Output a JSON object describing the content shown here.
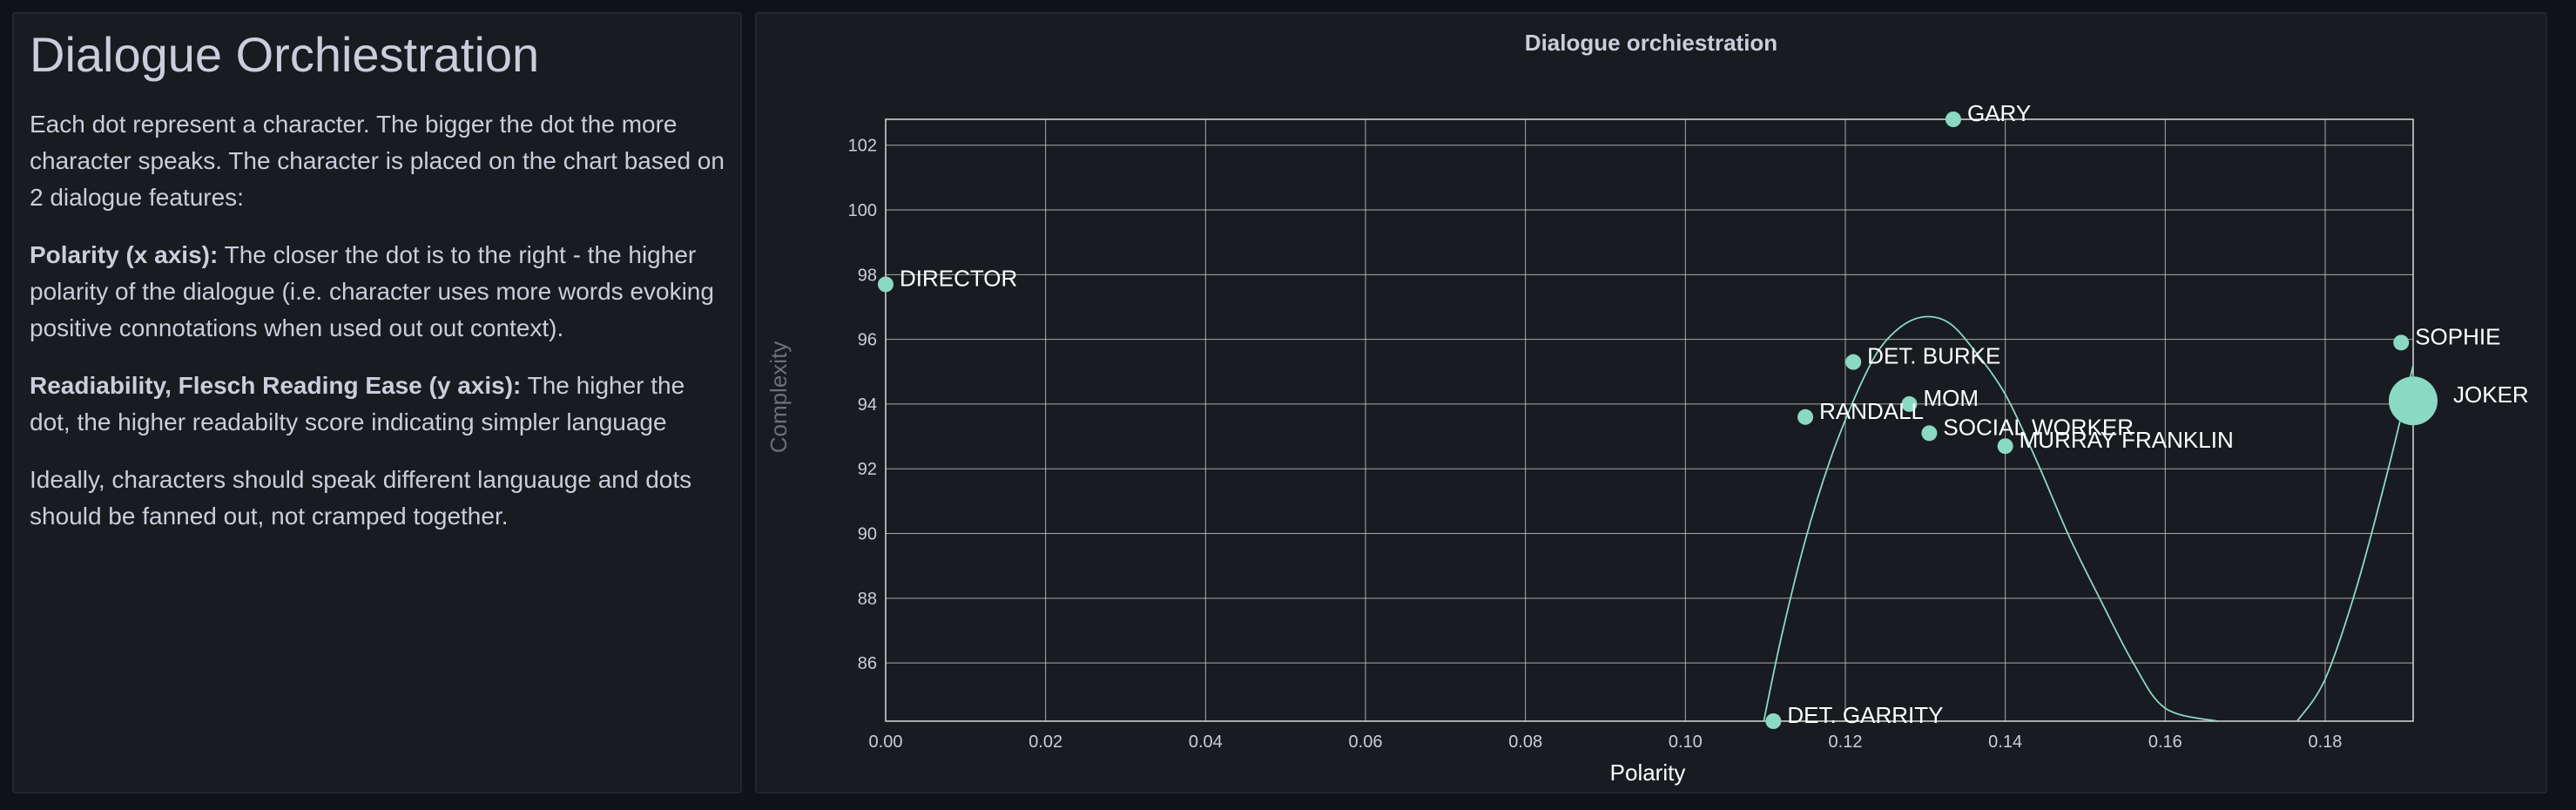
{
  "description_panel": {
    "title": "Dialogue Orchiestration",
    "intro": "Each dot represent a character. The bigger the dot the more character speaks. The character is placed on the chart based on 2 dialogue features:",
    "polarity_heading": "Polarity (x axis):",
    "polarity_text": " The closer the dot is to the right - the higher polarity of the dialogue (i.e. character uses more words evoking positive connotations when used out out context).",
    "readability_heading": "Readiability, Flesch Reading Ease (y axis):",
    "readability_text": " The higher the dot, the higher readabilty score indicating simpler language",
    "closing": "Ideally, characters should speak different languauge and dots should be fanned out, not cramped together."
  },
  "colors": {
    "marker": "#8ad9c3",
    "grid": "#d9d9d9",
    "panel_bg": "#181b1f"
  },
  "chart_data": {
    "type": "scatter",
    "title": "Dialogue orchiestration",
    "xlabel": "Polarity",
    "ylabel": "Complexity",
    "xlim": [
      0,
      0.191
    ],
    "ylim": [
      84.2,
      102.8
    ],
    "xticks": [
      0.0,
      0.02,
      0.04,
      0.06,
      0.08,
      0.1,
      0.12,
      0.14,
      0.16,
      0.18
    ],
    "yticks": [
      86,
      88,
      90,
      92,
      94,
      96,
      98,
      100,
      102
    ],
    "grid": true,
    "point_size_meaning": "bigger dot = character speaks more",
    "points": [
      {
        "name": "GARY",
        "x": 0.1335,
        "y": 102.8,
        "size": 1
      },
      {
        "name": "DIRECTOR",
        "x": 0.0,
        "y": 97.7,
        "size": 1
      },
      {
        "name": "SOPHIE",
        "x": 0.1895,
        "y": 95.9,
        "size": 1
      },
      {
        "name": "JOKER",
        "x": 0.191,
        "y": 94.1,
        "size": 6
      },
      {
        "name": "DET. BURKE",
        "x": 0.121,
        "y": 95.3,
        "size": 1
      },
      {
        "name": "MOM",
        "x": 0.128,
        "y": 94.0,
        "size": 1
      },
      {
        "name": "RANDALL",
        "x": 0.115,
        "y": 93.6,
        "size": 1
      },
      {
        "name": "SOCIAL WORKER",
        "x": 0.1305,
        "y": 93.1,
        "size": 1
      },
      {
        "name": "MURRAY FRANKLIN",
        "x": 0.14,
        "y": 92.7,
        "size": 1
      },
      {
        "name": "DET. GARRITY",
        "x": 0.111,
        "y": 84.2,
        "size": 1
      }
    ],
    "trend_curve": [
      [
        0.1098,
        84.2
      ],
      [
        0.112,
        86.8
      ],
      [
        0.115,
        89.8
      ],
      [
        0.118,
        92.2
      ],
      [
        0.121,
        94.1
      ],
      [
        0.124,
        95.6
      ],
      [
        0.127,
        96.4
      ],
      [
        0.13,
        96.7
      ],
      [
        0.133,
        96.5
      ],
      [
        0.136,
        95.7
      ],
      [
        0.14,
        94.3
      ],
      [
        0.144,
        92.2
      ],
      [
        0.148,
        89.9
      ],
      [
        0.152,
        87.9
      ],
      [
        0.156,
        86.0
      ],
      [
        0.16,
        84.6
      ],
      [
        0.1665,
        84.2
      ]
    ],
    "trend_curve_2": [
      [
        0.1765,
        84.2
      ],
      [
        0.18,
        85.5
      ],
      [
        0.184,
        88.4
      ],
      [
        0.188,
        92.1
      ],
      [
        0.191,
        95.2
      ]
    ]
  }
}
